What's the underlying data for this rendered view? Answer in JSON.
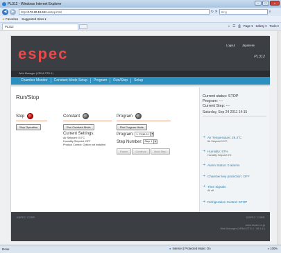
{
  "window": {
    "title": "PL312 - Windows Internet Explorer",
    "min": "–",
    "max": "□",
    "close": "×"
  },
  "address": {
    "prefix": "http://",
    "host": "172.20.10.63",
    "path": "/runstop.html",
    "search_placeholder": "Bing"
  },
  "favorites": {
    "label": "Favorites",
    "suggested": "Suggested Sites ▾"
  },
  "tab": {
    "label": "PL312"
  },
  "commandbar": {
    "page": "Page ▾",
    "safety": "Safety ▾",
    "tools": "Tools ▾"
  },
  "header": {
    "logo": "espec",
    "logout": "Logout",
    "japanese": "Japanese",
    "model": "PL312",
    "manager": "Web Manager (VRN4-STD-1)"
  },
  "nav": {
    "items": [
      "Chamber Monitor",
      "Constant Mode Setup",
      "Program",
      "Run/Stop",
      "Setup"
    ]
  },
  "main": {
    "title": "Run/Stop",
    "stop": {
      "heading": "Stop",
      "button": "Stop Operation"
    },
    "constant": {
      "heading": "Constant",
      "button": "Run Constant Mode",
      "settings_title": "Current Settings:",
      "lines": [
        "Air Setpoint: 0.0°C",
        "Humidity Setpoint: OFF",
        "Product Control: Option not installed"
      ]
    },
    "program": {
      "heading": "Program",
      "button": "Run Program Mode",
      "program_label": "Program:",
      "program_value": "1: PGM-01",
      "step_label": "Step Number:",
      "step_value": "Step 1",
      "pause": "Pause",
      "continue": "Continue",
      "next_step": "Next Step"
    }
  },
  "status": {
    "current_status": "Current status: STOP",
    "program": "Program: ---",
    "current_step": "Current Step: ---",
    "date": "Saturday, Sep 24 2011 14:15",
    "air_temp": "Air Temperature: 28.4°C",
    "air_sp": "Air Setpoint 0.0°C",
    "humidity": "Humidity: 97%",
    "humidity_sp": "Humidity Setpoint 0%",
    "alarm": "Alarm Status: 0 alarms",
    "key": "Chamber key protection: OFF",
    "time_signals": "Time Signals",
    "time_sub": "All off",
    "refrig": "Refrigeration Control: STOP"
  },
  "footer": {
    "left": "ESPEC CORP.",
    "right": "ESPEC CORP.",
    "url": "www.espec.co.jp",
    "version": "Web Manager (VRN4-STD-1 / 98.1.4 )"
  },
  "statusbar": {
    "left": "Done",
    "zone": "Internet | Protected Mode: On",
    "zoom": "100%"
  },
  "colors": {
    "header": "#3b3f44",
    "nav": "#2b8fbf",
    "logo": "#e84a4a"
  }
}
